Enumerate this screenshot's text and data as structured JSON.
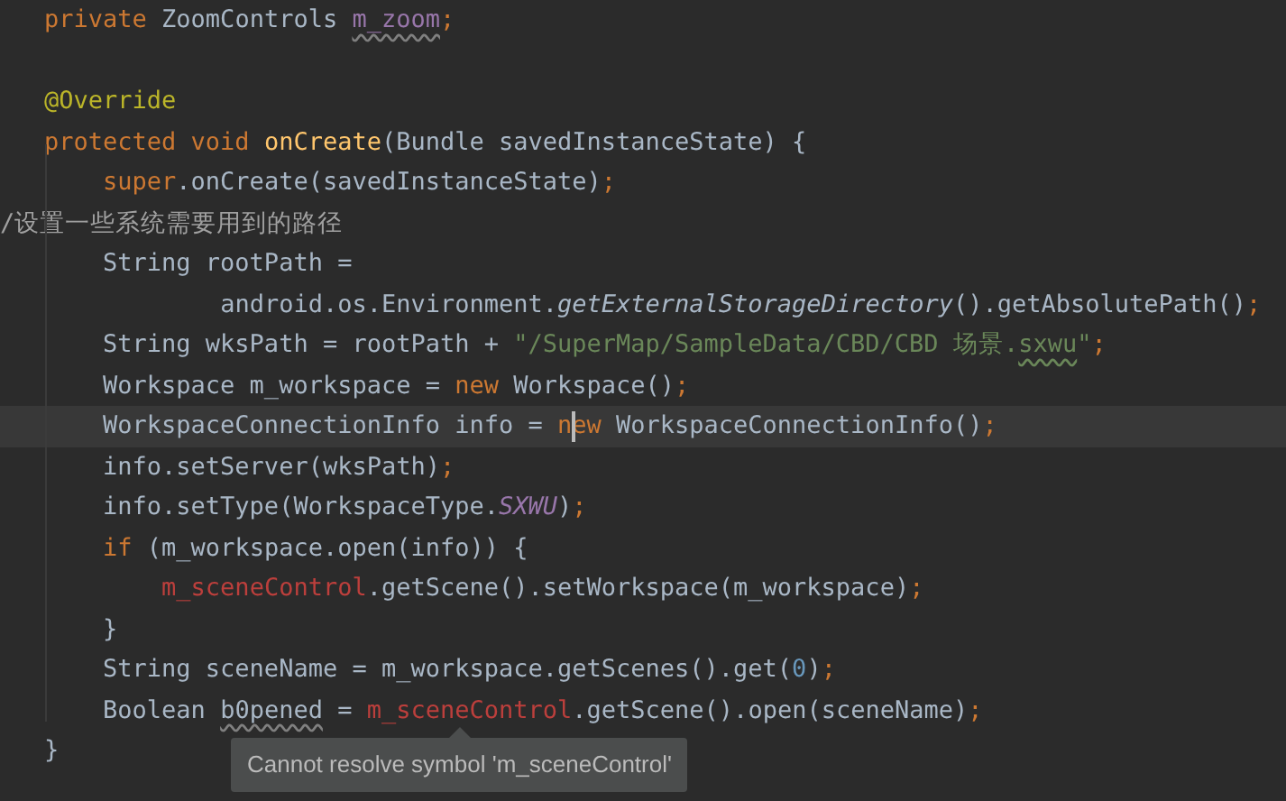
{
  "editor": {
    "lines": [
      {
        "current": false,
        "tokens": [
          {
            "kind": "keyword",
            "text": "private"
          },
          {
            "kind": "plain",
            "text": " ZoomControls "
          },
          {
            "kind": "field",
            "text": "m_zoom",
            "squiggle": true
          },
          {
            "kind": "semi",
            "text": ";"
          }
        ]
      },
      {
        "current": false
      },
      {
        "current": false,
        "tokens": [
          {
            "kind": "annotation",
            "text": "@Override"
          }
        ]
      },
      {
        "current": false,
        "tokens": [
          {
            "kind": "keyword",
            "text": "protected void "
          },
          {
            "kind": "method",
            "text": "onCreate"
          },
          {
            "kind": "plain",
            "text": "(Bundle savedInstanceState) {"
          }
        ],
        "children": [
          {
            "current": false,
            "tokens": [
              {
                "kind": "keyword",
                "text": "super"
              },
              {
                "kind": "plain",
                "text": ".onCreate(savedInstanceState)"
              },
              {
                "kind": "semi",
                "text": ";"
              }
            ]
          },
          {
            "kind": "flush",
            "current": false,
            "tokens": [
              {
                "kind": "comment",
                "text": "/设置一些系统需要用到的路径"
              }
            ]
          },
          {
            "current": false,
            "tokens": [
              {
                "kind": "plain",
                "text": "String rootPath ="
              }
            ],
            "children": [
              {
                "kind": "continuation",
                "current": false,
                "tokens": [
                  {
                    "kind": "plain",
                    "text": "android.os.Environment."
                  },
                  {
                    "kind": "static",
                    "text": "getExternalStorageDirectory"
                  },
                  {
                    "kind": "plain",
                    "text": "().getAbsolutePath()"
                  },
                  {
                    "kind": "semi",
                    "text": ";"
                  }
                ]
              }
            ]
          },
          {
            "current": false,
            "tokens": [
              {
                "kind": "plain",
                "text": "String wksPath = rootPath + "
              },
              {
                "kind": "string",
                "text": "\"/SuperMap/SampleData/CBD/CBD 场景."
              },
              {
                "kind": "string",
                "text": "sxwu",
                "squiggle": true
              },
              {
                "kind": "string",
                "text": "\""
              },
              {
                "kind": "semi",
                "text": ";"
              }
            ]
          },
          {
            "current": false,
            "tokens": [
              {
                "kind": "plain",
                "text": "Workspace m_workspace = "
              },
              {
                "kind": "keyword",
                "text": "new"
              },
              {
                "kind": "plain",
                "text": " Workspace()"
              },
              {
                "kind": "semi",
                "text": ";"
              }
            ]
          },
          {
            "current": true,
            "tokens": [
              {
                "kind": "plain",
                "text": "WorkspaceConnectionInfo info = "
              },
              {
                "kind": "keyword",
                "text": "new",
                "caret": true
              },
              {
                "kind": "plain",
                "text": " WorkspaceConnectionInfo()"
              },
              {
                "kind": "semi",
                "text": ";"
              }
            ]
          },
          {
            "current": false,
            "tokens": [
              {
                "kind": "plain",
                "text": "info.setServer(wksPath)"
              },
              {
                "kind": "semi",
                "text": ";"
              }
            ]
          },
          {
            "current": false,
            "tokens": [
              {
                "kind": "plain",
                "text": "info.setType(WorkspaceType."
              },
              {
                "kind": "constant",
                "text": "SXWU"
              },
              {
                "kind": "plain",
                "text": ")"
              },
              {
                "kind": "semi",
                "text": ";"
              }
            ]
          },
          {
            "current": false,
            "tokens": [
              {
                "kind": "keyword",
                "text": "if"
              },
              {
                "kind": "plain",
                "text": " (m_workspace.open(info)) {"
              }
            ],
            "children": [
              {
                "current": false,
                "tokens": [
                  {
                    "kind": "error",
                    "text": "m_sceneControl"
                  },
                  {
                    "kind": "plain",
                    "text": ".getScene().setWorkspace(m_workspace)"
                  },
                  {
                    "kind": "semi",
                    "text": ";"
                  }
                ]
              }
            ]
          },
          {
            "current": false,
            "tokens": [
              {
                "kind": "plain",
                "text": "}"
              }
            ]
          },
          {
            "current": false,
            "tokens": [
              {
                "kind": "plain",
                "text": "String sceneName = m_workspace.getScenes().get("
              },
              {
                "kind": "number",
                "text": "0"
              },
              {
                "kind": "plain",
                "text": ")"
              },
              {
                "kind": "semi",
                "text": ";"
              }
            ]
          },
          {
            "current": false,
            "tokens": [
              {
                "kind": "plain",
                "text": "Boolean "
              },
              {
                "kind": "unused",
                "text": "b0pened",
                "squiggle": true
              },
              {
                "kind": "plain",
                "text": " = "
              },
              {
                "kind": "error",
                "text": "m_sceneControl"
              },
              {
                "kind": "plain",
                "text": ".getScene().open(sceneName)"
              },
              {
                "kind": "semi",
                "text": ";"
              }
            ]
          }
        ]
      },
      {
        "current": false,
        "tokens": [
          {
            "kind": "plain",
            "text": "}"
          }
        ]
      }
    ]
  },
  "tooltip": {
    "text": "Cannot resolve symbol 'm_sceneControl'"
  }
}
